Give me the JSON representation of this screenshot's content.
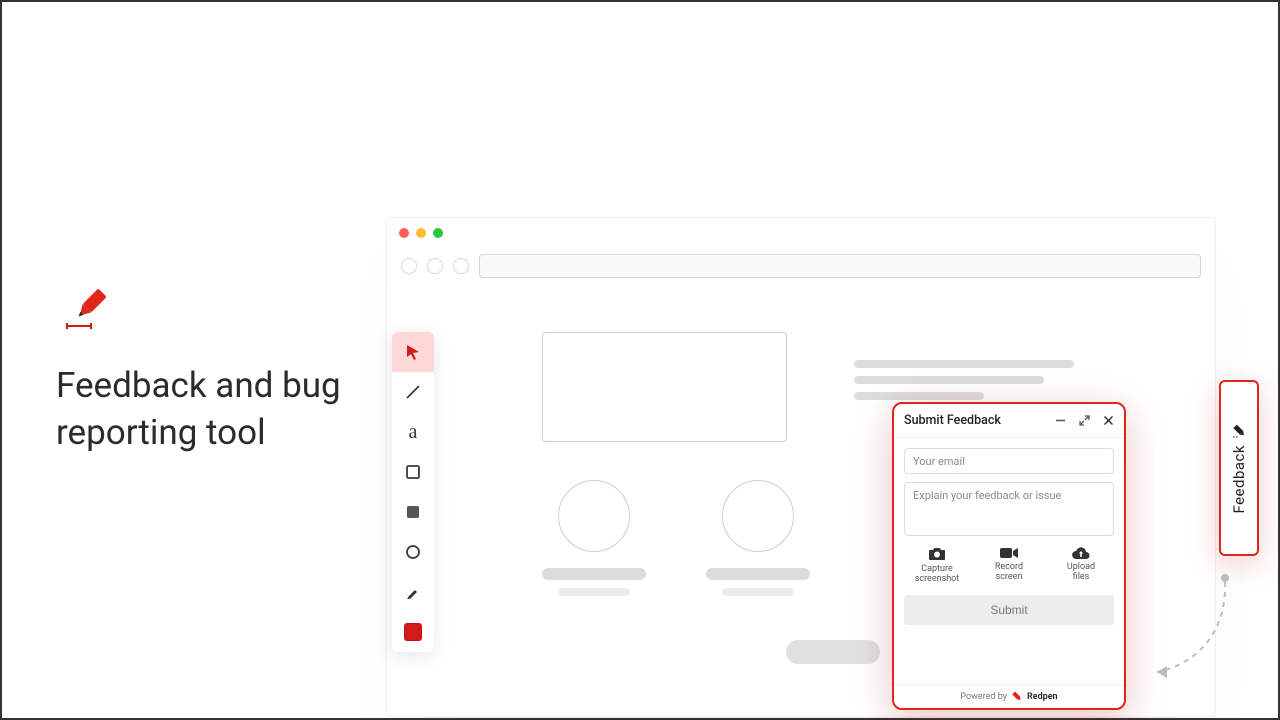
{
  "headline": "Feedback and bug\nreporting tool",
  "palette": {
    "tools": [
      "pointer",
      "line",
      "text",
      "rect-outline",
      "rect-fill",
      "circle-outline",
      "highlighter",
      "color"
    ]
  },
  "feedback_panel": {
    "title": "Submit Feedback",
    "email_placeholder": "Your email",
    "message_placeholder": "Explain your feedback or issue",
    "actions": {
      "capture": "Capture\nscreenshot",
      "record": "Record\nscreen",
      "upload": "Upload\nfiles"
    },
    "submit_label": "Submit",
    "footer_prefix": "Powered by",
    "footer_brand": "Redpen"
  },
  "side_tab": {
    "label": "Feedback"
  }
}
